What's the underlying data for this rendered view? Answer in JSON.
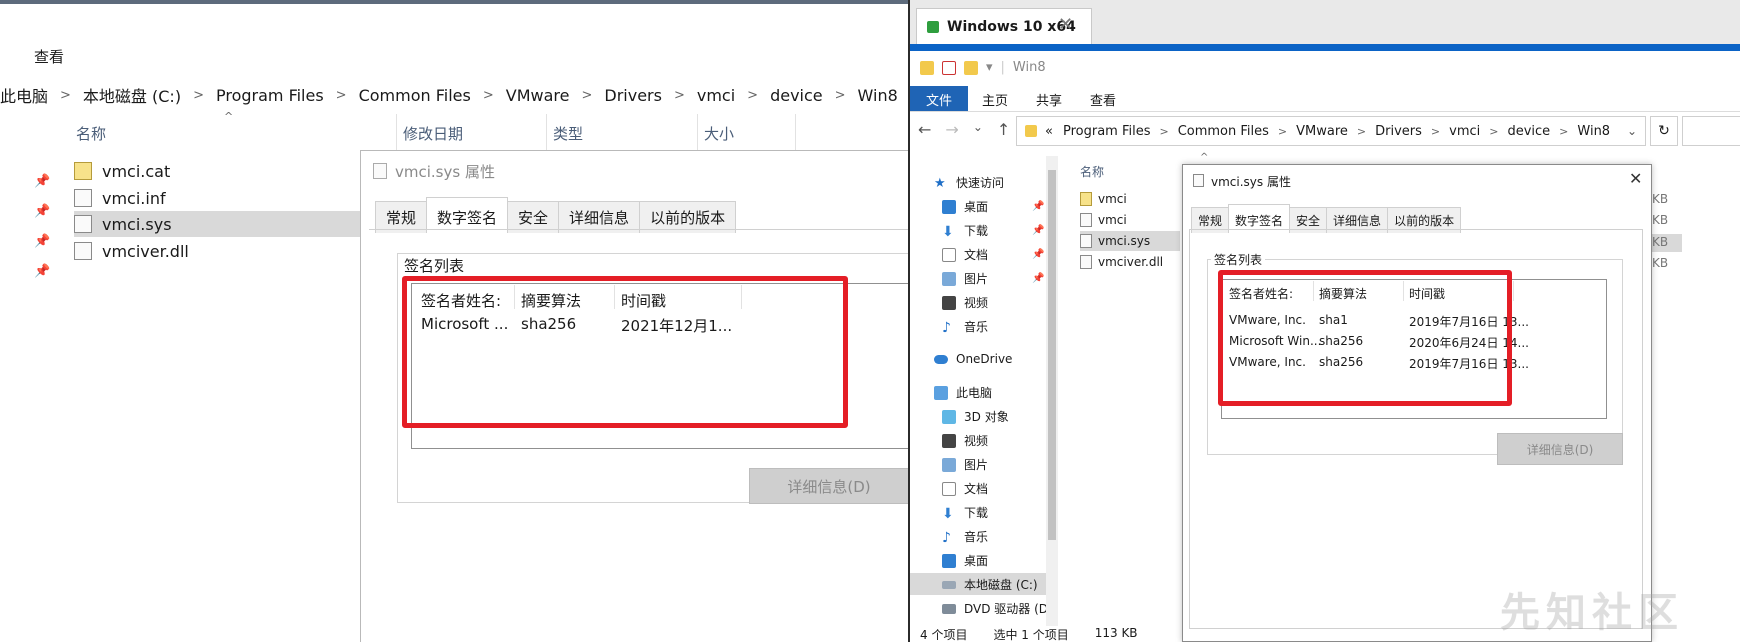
{
  "left": {
    "menu": "查看",
    "breadcrumb": [
      "此电脑",
      "本地磁盘 (C:)",
      "Program Files",
      "Common Files",
      "VMware",
      "Drivers",
      "vmci",
      "device",
      "Win8"
    ],
    "columns": [
      "名称",
      "修改日期",
      "类型",
      "大小"
    ],
    "files": [
      "vmci.cat",
      "vmci.inf",
      "vmci.sys",
      "vmciver.dll"
    ],
    "dialog": {
      "title": "vmci.sys 属性",
      "tabs": [
        "常规",
        "数字签名",
        "安全",
        "详细信息",
        "以前的版本"
      ],
      "group_label": "签名列表",
      "list_headers": [
        "签名者姓名:",
        "摘要算法",
        "时间戳"
      ],
      "rows": [
        {
          "name": "Microsoft ...",
          "algo": "sha256",
          "time": "2021年12月1..."
        }
      ],
      "details_button": "详细信息(D)"
    }
  },
  "right": {
    "vm_tab": "Windows 10 x64",
    "vm_tab_close": "✕",
    "qat_path": "Win8",
    "ribbon": [
      "文件",
      "主页",
      "共享",
      "查看"
    ],
    "nav_buttons": [
      "←",
      "→",
      "⌄",
      "↑"
    ],
    "address_prefix": "«",
    "breadcrumb": [
      "Program Files",
      "Common Files",
      "VMware",
      "Drivers",
      "vmci",
      "device",
      "Win8"
    ],
    "refresh": "↻",
    "nav_items": {
      "quick": "快速访问",
      "desktop": "桌面",
      "downloads": "下载",
      "docs": "文档",
      "pics": "图片",
      "videos": "视频",
      "music": "音乐",
      "onedrive": "OneDrive",
      "thispc": "此电脑",
      "obj3d": "3D 对象",
      "videos2": "视频",
      "pics2": "图片",
      "docs2": "文档",
      "downloads2": "下载",
      "music2": "音乐",
      "desktop2": "桌面",
      "localc": "本地磁盘 (C:)",
      "dvd": "DVD 驱动器 (D"
    },
    "column_name": "名称",
    "files": [
      "vmci",
      "vmci",
      "vmci.sys",
      "vmciver.dll"
    ],
    "sizes": [
      "KB",
      "KB",
      "KB",
      "KB"
    ],
    "status": {
      "count": "4 个项目",
      "selected": "选中 1 个项目",
      "size": "113 KB"
    },
    "dialog": {
      "title": "vmci.sys 属性",
      "close": "✕",
      "tabs": [
        "常规",
        "数字签名",
        "安全",
        "详细信息",
        "以前的版本"
      ],
      "group_label": "签名列表",
      "list_headers": [
        "签名者姓名:",
        "摘要算法",
        "时间戳"
      ],
      "rows": [
        {
          "name": "VMware, Inc.",
          "algo": "sha1",
          "time": "2019年7月16日 13..."
        },
        {
          "name": "Microsoft Win...",
          "algo": "sha256",
          "time": "2020年6月24日 14..."
        },
        {
          "name": "VMware, Inc.",
          "algo": "sha256",
          "time": "2019年7月16日 13..."
        }
      ],
      "details_button": "详细信息(D)"
    }
  },
  "watermark": "先知社区",
  "colors": {
    "highlight_red": "#e41e26",
    "vm_blue": "#0b63c6",
    "ribbon_file": "#1f64b5",
    "selection": "#d9d9d9"
  }
}
